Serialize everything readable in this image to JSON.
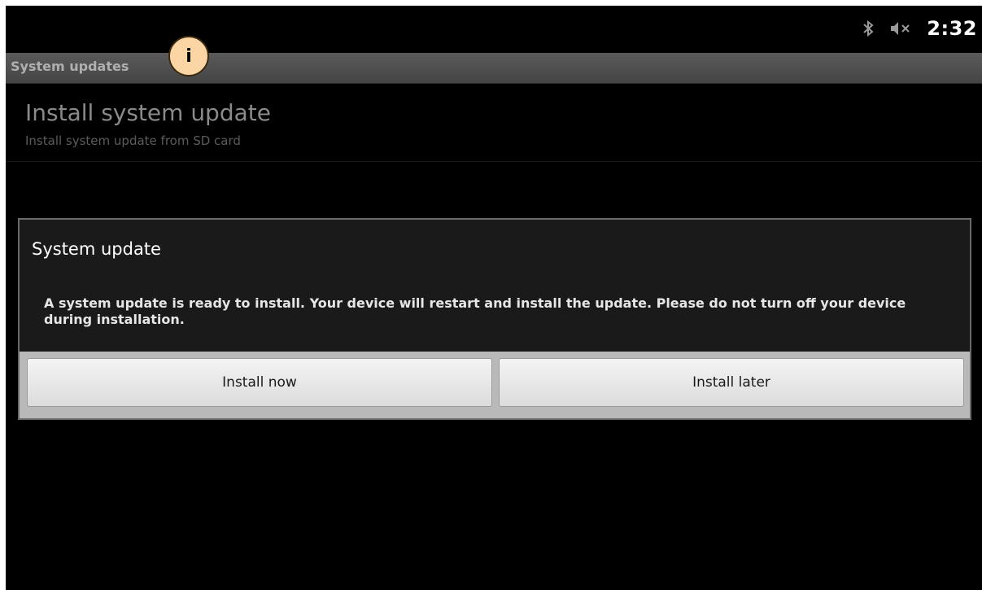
{
  "status_bar": {
    "time": "2:32",
    "icons": [
      "bluetooth-icon",
      "volume-muted-icon"
    ]
  },
  "title_bar": {
    "title": "System updates"
  },
  "info_badge": {
    "label": "i"
  },
  "preference": {
    "title": "Install system update",
    "summary": "Install system update from SD card"
  },
  "dialog": {
    "title": "System update",
    "message": "A system update is ready to install. Your device will restart and install the update. Please do not turn off your device during installation.",
    "buttons": {
      "install_now": "Install now",
      "install_later": "Install later"
    }
  },
  "colors": {
    "title_bar": "#4f4f4f",
    "info_badge": "#fcd5a4",
    "button_bar": "#b9b9b9"
  }
}
